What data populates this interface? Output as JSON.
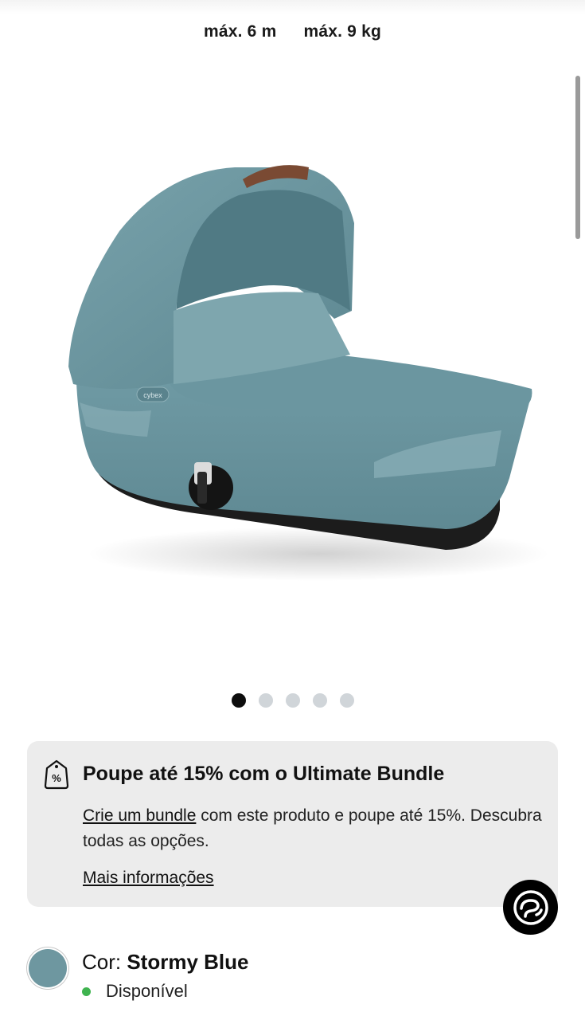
{
  "specs": [
    "máx. 6 m",
    "máx. 9 kg"
  ],
  "product": {
    "image_alt": "Alcofa azul acinzentada",
    "brand_mark": "cybex"
  },
  "carousel": {
    "total": 5,
    "active_index": 0
  },
  "bundle": {
    "icon": "percent-tag-icon",
    "title": "Poupe até 15% com o Ultimate Bundle",
    "link_text": "Crie um bundle",
    "body_rest": " com este produto e poupe até 15%. Descubra todas as opções.",
    "more_info": "Mais informações"
  },
  "chat": {
    "icon": "chat-logo-icon"
  },
  "color": {
    "label": "Cor: ",
    "name": "Stormy Blue",
    "swatch_hex": "#6e97a0",
    "availability": "Disponível",
    "availability_color": "#3fb34f"
  }
}
